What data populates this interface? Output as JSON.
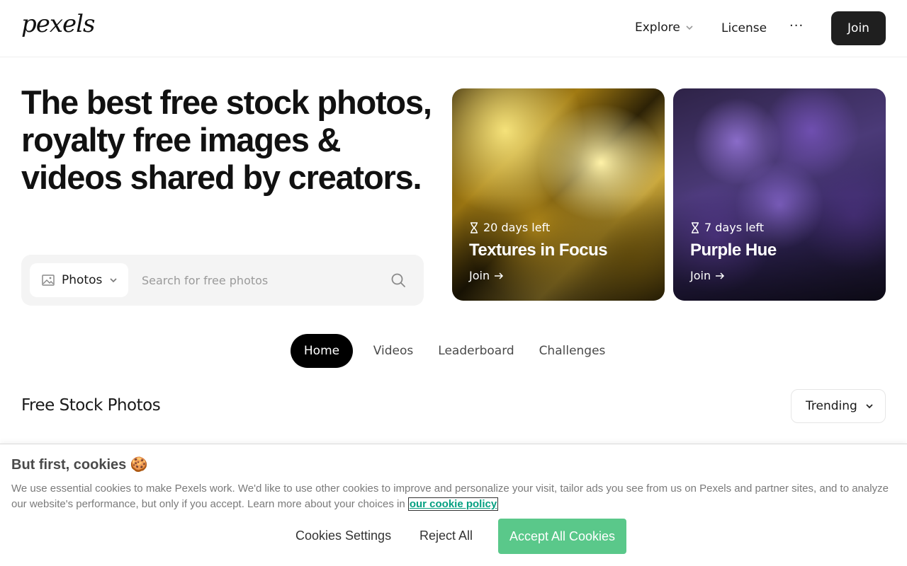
{
  "header": {
    "logo": "pexels",
    "nav": {
      "explore": "Explore",
      "license": "License",
      "more": "···",
      "join": "Join"
    }
  },
  "hero": {
    "title": "The best free stock photos, royalty free images & videos shared by creators.",
    "search": {
      "type_label": "Photos",
      "placeholder": "Search for free photos",
      "value": ""
    }
  },
  "challenges": [
    {
      "days_left": "20 days left",
      "title": "Textures in Focus",
      "join": "Join",
      "image": "gold-foil-texture"
    },
    {
      "days_left": "7 days left",
      "title": "Purple Hue",
      "join": "Join",
      "image": "lilac-flowers"
    }
  ],
  "tabs": [
    {
      "label": "Home",
      "active": true
    },
    {
      "label": "Videos",
      "active": false
    },
    {
      "label": "Leaderboard",
      "active": false
    },
    {
      "label": "Challenges",
      "active": false
    }
  ],
  "feed": {
    "title": "Free Stock Photos",
    "sort": "Trending"
  },
  "cookie_banner": {
    "title": "But first, cookies 🍪",
    "text": "We use essential cookies to make Pexels work. We'd like to use other cookies to improve and personalize your visit, tailor ads you see from us on Pexels and partner sites, and to analyze our website's performance, but only if you accept. Learn more about your choices in",
    "link": "our cookie policy",
    "settings": "Cookies Settings",
    "reject": "Reject All",
    "accept": "Accept All Cookies"
  },
  "colors": {
    "primary_dark": "#1f1f1f",
    "accent_green": "#05a081",
    "cookie_accept": "#5ac88a",
    "search_bg": "#f4f4f4"
  },
  "icons": [
    "chevron-down-icon",
    "image-icon",
    "search-icon",
    "hourglass-icon",
    "arrow-right-icon"
  ]
}
